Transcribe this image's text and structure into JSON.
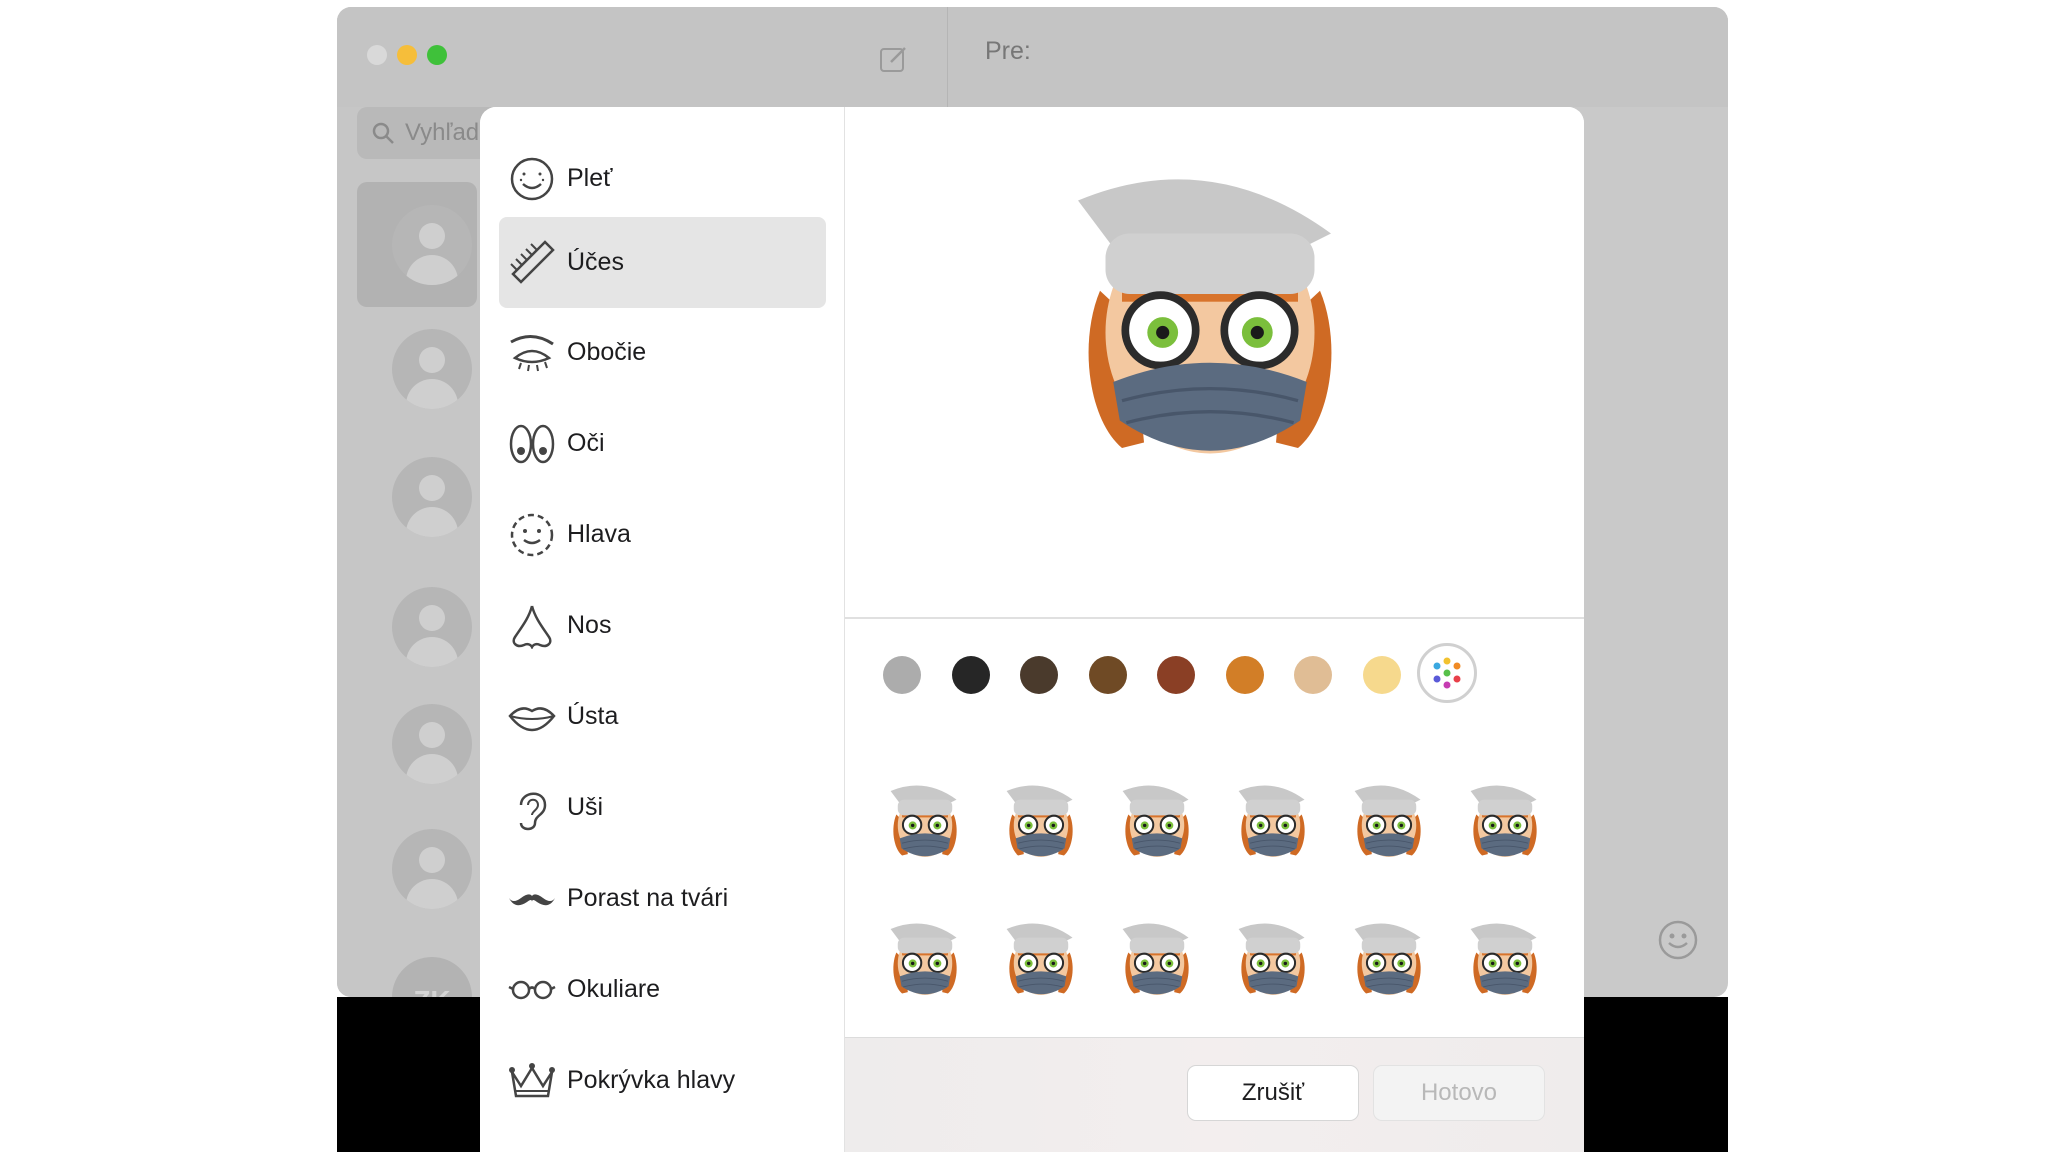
{
  "window": {
    "to_label": "Pre:",
    "search_placeholder": "Vyhľad",
    "last_avatar_initials": "ZK"
  },
  "memoji_editor": {
    "categories": [
      {
        "label": "Pleť",
        "icon": "face-freckles-icon"
      },
      {
        "label": "Účes",
        "icon": "comb-icon",
        "selected": true
      },
      {
        "label": "Obočie",
        "icon": "eyebrow-icon"
      },
      {
        "label": "Oči",
        "icon": "eyes-icon"
      },
      {
        "label": "Hlava",
        "icon": "head-shape-icon"
      },
      {
        "label": "Nos",
        "icon": "nose-icon"
      },
      {
        "label": "Ústa",
        "icon": "lips-icon"
      },
      {
        "label": "Uši",
        "icon": "ear-icon"
      },
      {
        "label": "Porast na tvári",
        "icon": "mustache-icon"
      },
      {
        "label": "Okuliare",
        "icon": "glasses-icon"
      },
      {
        "label": "Pokrývka hlavy",
        "icon": "crown-icon"
      }
    ],
    "hair_colors": [
      "#acacac",
      "#262626",
      "#4a3a2c",
      "#6f4a25",
      "#8a3f25",
      "#d27e27",
      "#e0bd95",
      "#f6d98d"
    ],
    "custom_color_icon": "color-wheel-icon",
    "buttons": {
      "cancel": "Zrušiť",
      "done": "Hotovo"
    }
  }
}
